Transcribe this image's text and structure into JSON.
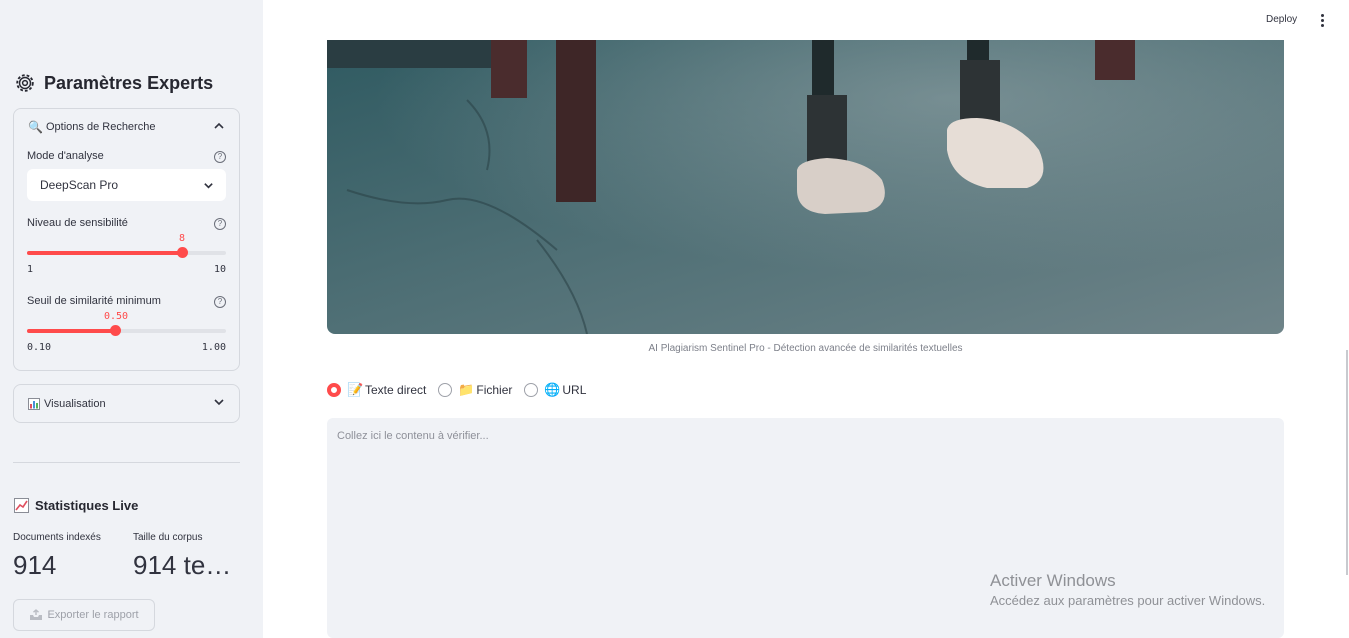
{
  "sidebar": {
    "title": "Paramètres Experts",
    "search_options": {
      "label": "Options de Recherche",
      "icon": "magnifier-icon",
      "mode": {
        "label": "Mode d'analyse",
        "value": "DeepScan Pro"
      },
      "sensitivity": {
        "label": "Niveau de sensibilité",
        "value": "8",
        "min": "1",
        "max": "10",
        "fraction": 0.78
      },
      "threshold": {
        "label": "Seuil de similarité minimum",
        "value": "0.50",
        "min": "0.10",
        "max": "1.00",
        "fraction": 0.44
      }
    },
    "visualisation": {
      "label": "Visualisation",
      "icon": "bar-chart-icon"
    },
    "stats": {
      "title": "Statistiques Live",
      "metrics": [
        {
          "label": "Documents indexés",
          "value": "914"
        },
        {
          "label": "Taille du corpus",
          "value": "914 te…"
        }
      ]
    },
    "export_label": "Exporter le rapport"
  },
  "header": {
    "deploy_label": "Deploy"
  },
  "main": {
    "image_caption": "AI Plagiarism Sentinel Pro - Détection avancée de similarités textuelles",
    "input_options": [
      {
        "label": "Texte direct",
        "icon": "memo-icon",
        "selected": true
      },
      {
        "label": "Fichier",
        "icon": "folder-icon",
        "selected": false
      },
      {
        "label": "URL",
        "icon": "globe-icon",
        "selected": false
      }
    ],
    "textarea_placeholder": "Collez ici le contenu à vérifier..."
  },
  "watermark": {
    "title": "Activer Windows",
    "subtitle": "Accédez aux paramètres pour activer Windows."
  },
  "colors": {
    "accent": "#ff4b4b",
    "sidebar_bg": "#f0f2f6"
  }
}
